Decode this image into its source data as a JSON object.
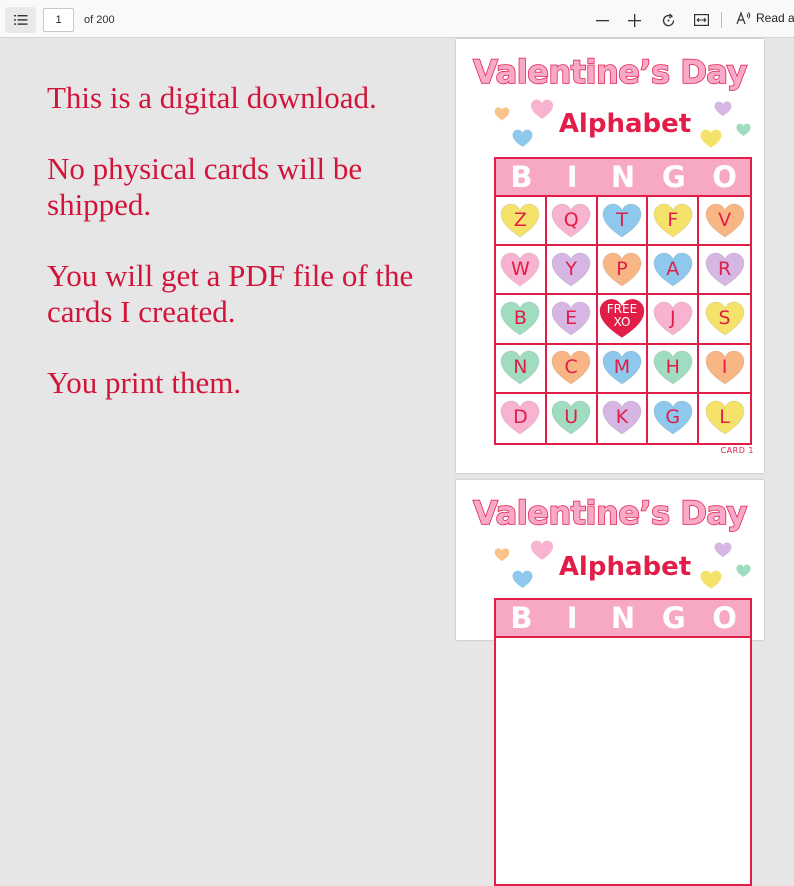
{
  "toolbar": {
    "page_number": "1",
    "page_of": "of 200",
    "read_aloud": "Read al"
  },
  "message": {
    "lines": [
      "This is a digital download.",
      "No physical cards will be shipped.",
      "You will get a PDF file of the cards I created.",
      "You print them."
    ]
  },
  "card": {
    "title": "Valentine’s Day",
    "subtitle": "Alphabet",
    "header": [
      "B",
      "I",
      "N",
      "G",
      "O"
    ],
    "label": "CARD 1",
    "free": [
      "FREE",
      "XO"
    ],
    "cells": [
      {
        "letter": "Z",
        "color": "#f5e26a"
      },
      {
        "letter": "Q",
        "color": "#f7b3cf"
      },
      {
        "letter": "T",
        "color": "#8ec8ec"
      },
      {
        "letter": "F",
        "color": "#f5e26a"
      },
      {
        "letter": "V",
        "color": "#f8b684"
      },
      {
        "letter": "W",
        "color": "#f7b3cf"
      },
      {
        "letter": "Y",
        "color": "#d6b6e3"
      },
      {
        "letter": "P",
        "color": "#f8b684"
      },
      {
        "letter": "A",
        "color": "#8ec8ec"
      },
      {
        "letter": "R",
        "color": "#d6b6e3"
      },
      {
        "letter": "B",
        "color": "#9fdcc0"
      },
      {
        "letter": "E",
        "color": "#d6b6e3"
      },
      {
        "letter": "FREE",
        "color": "#e11d48"
      },
      {
        "letter": "J",
        "color": "#f7b3cf"
      },
      {
        "letter": "S",
        "color": "#f5e26a"
      },
      {
        "letter": "N",
        "color": "#9fdcc0"
      },
      {
        "letter": "C",
        "color": "#f8b684"
      },
      {
        "letter": "M",
        "color": "#8ec8ec"
      },
      {
        "letter": "H",
        "color": "#9fdcc0"
      },
      {
        "letter": "I",
        "color": "#f8b684"
      },
      {
        "letter": "D",
        "color": "#f7b3cf"
      },
      {
        "letter": "U",
        "color": "#9fdcc0"
      },
      {
        "letter": "K",
        "color": "#d6b6e3"
      },
      {
        "letter": "G",
        "color": "#8ec8ec"
      },
      {
        "letter": "L",
        "color": "#f5e26a"
      }
    ]
  },
  "colors": {
    "accent": "#e11d48",
    "message_text": "#d2143a",
    "header_pink": "#f7a9c4"
  }
}
